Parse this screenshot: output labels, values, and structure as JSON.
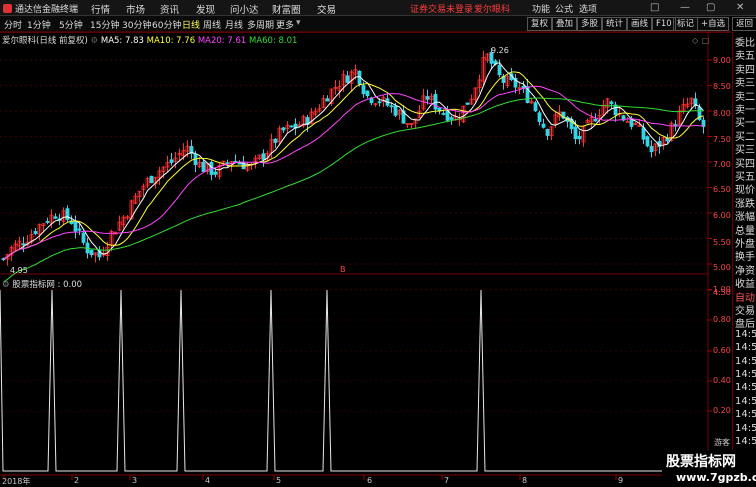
{
  "app": {
    "brand": "通达信金融终端",
    "menu": [
      "行情",
      "市场",
      "资讯",
      "发现",
      "问小达",
      "财富圈",
      "交易"
    ],
    "notice": "证券交易未登录",
    "stock_name_top": "爱尔眼科",
    "right_menu": [
      "功能",
      "公式",
      "选项"
    ],
    "window_controls": [
      "□",
      "—",
      "▢",
      "✕"
    ]
  },
  "toolbar": {
    "periods": [
      "分时",
      "1分钟",
      "5分钟",
      "15分钟",
      "30分钟",
      "60分钟",
      "日线",
      "周线",
      "月线",
      "多周期",
      "更多"
    ],
    "active_period": "日线",
    "right_buttons": [
      "复权",
      "叠加",
      "多股",
      "统计",
      "画线",
      "F10",
      "标记",
      "+自选",
      "返回"
    ]
  },
  "chart": {
    "title": "爱尔眼科(日线 前复权)",
    "ma": [
      {
        "label": "MA5: 7.83",
        "color": "#ffffff"
      },
      {
        "label": "MA10: 7.76",
        "color": "#ffff33"
      },
      {
        "label": "MA20: 7.61",
        "color": "#ff44ff"
      },
      {
        "label": "MA60: 8.01",
        "color": "#33dd33"
      }
    ],
    "price_ticks": [
      "9.00",
      "8.50",
      "8.00",
      "7.50",
      "7.00",
      "6.50",
      "6.00",
      "5.50",
      "5.00",
      "4.50"
    ],
    "high_label": "9.26",
    "low_label": "4.95",
    "marker": "B",
    "indicator_title": "股票指标网 : 0.00",
    "ind_ticks": [
      "1.00",
      "0.80",
      "0.60",
      "0.40",
      "0.20"
    ],
    "ind_label": "游客",
    "x_labels": [
      "2018年",
      "2",
      "3",
      "4",
      "5",
      "6",
      "7",
      "8",
      "9"
    ]
  },
  "side_panel": [
    {
      "t": "委比",
      "c": "normal"
    },
    {
      "t": "卖五",
      "c": "normal"
    },
    {
      "t": "卖四",
      "c": "normal"
    },
    {
      "t": "卖三",
      "c": "normal"
    },
    {
      "t": "卖二",
      "c": "normal"
    },
    {
      "t": "卖一",
      "c": "normal"
    },
    {
      "t": "买一",
      "c": "normal"
    },
    {
      "t": "买二",
      "c": "normal"
    },
    {
      "t": "买三",
      "c": "normal"
    },
    {
      "t": "买四",
      "c": "normal"
    },
    {
      "t": "买五",
      "c": "normal"
    },
    {
      "t": "现价",
      "c": "normal"
    },
    {
      "t": "涨跌",
      "c": "normal"
    },
    {
      "t": "涨幅",
      "c": "normal"
    },
    {
      "t": "总量",
      "c": "normal"
    },
    {
      "t": "外盘",
      "c": "normal"
    },
    {
      "t": "换手",
      "c": "normal"
    },
    {
      "t": "净资",
      "c": "normal"
    },
    {
      "t": "收益",
      "c": "normal"
    },
    {
      "t": "自动",
      "c": "red"
    },
    {
      "t": "交易",
      "c": "normal"
    },
    {
      "t": "盘后",
      "c": "normal"
    },
    {
      "t": "14:5",
      "c": "normal"
    },
    {
      "t": "14:5",
      "c": "normal"
    },
    {
      "t": "14:5",
      "c": "normal"
    },
    {
      "t": "14:5",
      "c": "normal"
    },
    {
      "t": "14:5",
      "c": "normal"
    },
    {
      "t": "14:5",
      "c": "normal"
    },
    {
      "t": "14:5",
      "c": "normal"
    },
    {
      "t": "14:5",
      "c": "normal"
    },
    {
      "t": "14:5",
      "c": "normal"
    }
  ],
  "watermark": {
    "line1": "股票指标网",
    "line2": "www.7gpzb.com"
  }
}
